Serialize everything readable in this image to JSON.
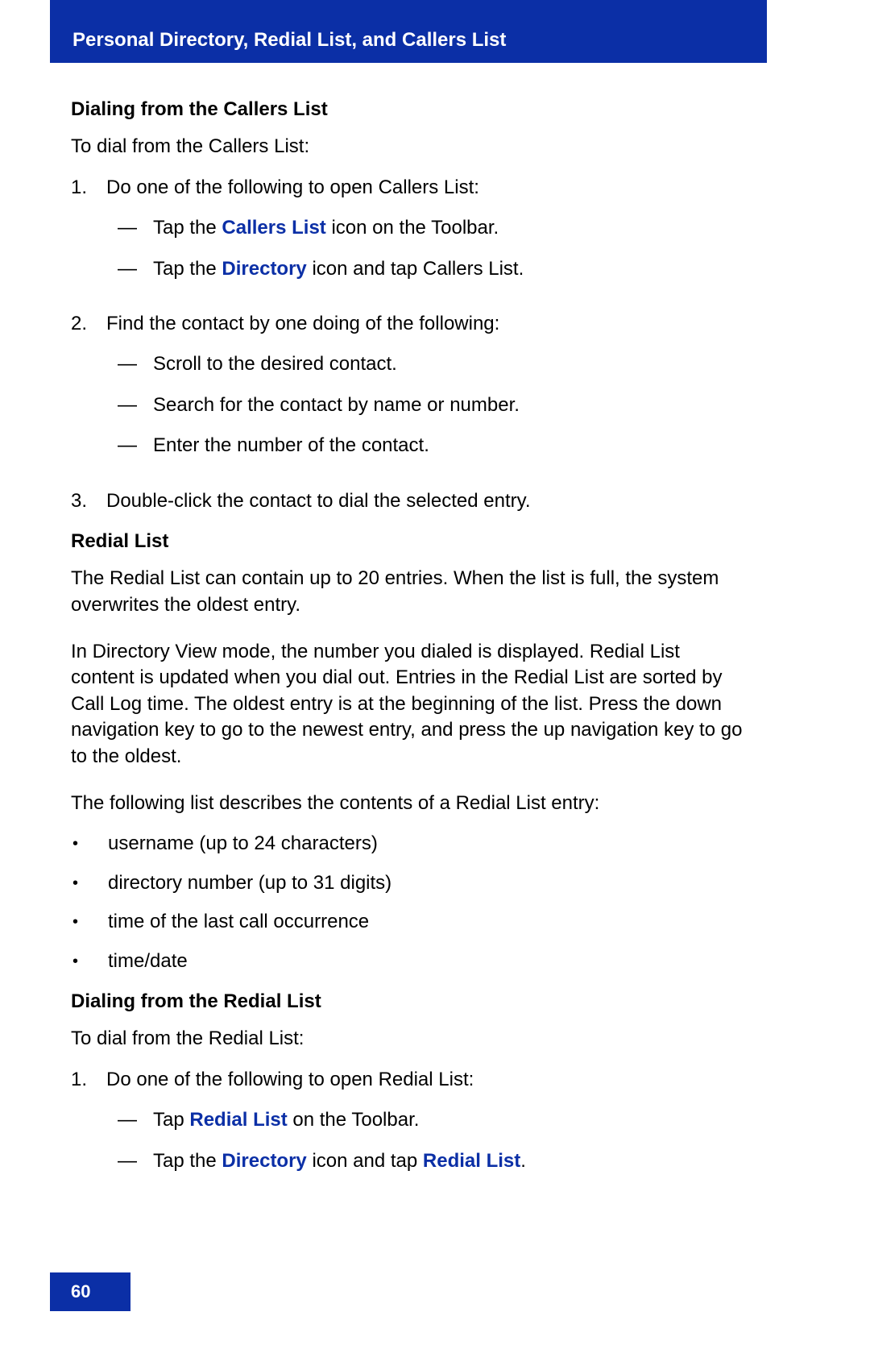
{
  "header": {
    "title": "Personal Directory, Redial List, and Callers List"
  },
  "footer": {
    "page_number": "60"
  },
  "section1": {
    "heading": "Dialing from the Callers List",
    "intro": "To dial from the Callers List:",
    "step1": {
      "num": "1.",
      "text": "Do one of the following to open Callers List:",
      "d1_pre": "Tap the ",
      "d1_link": "Callers List",
      "d1_post": " icon on the Toolbar.",
      "d2_pre": "Tap the ",
      "d2_link": "Directory",
      "d2_post": " icon and tap Callers List."
    },
    "step2": {
      "num": "2.",
      "text": "Find the contact by one doing of the following:",
      "d1": "Scroll to the desired contact.",
      "d2": "Search for the contact by name or number.",
      "d3": "Enter the number of the contact."
    },
    "step3": {
      "num": "3.",
      "text": "Double-click the contact to dial the selected entry."
    }
  },
  "section2": {
    "heading": "Redial List",
    "para1": "The Redial List can contain up to 20 entries. When the list is full, the system overwrites the oldest entry.",
    "para2": "In Directory View mode, the number you dialed is displayed. Redial List content is updated when you dial out. Entries in the Redial List are sorted by Call Log time. The oldest entry is at the beginning of the list. Press the down navigation key to go to the newest entry, and press the up navigation key to go to the oldest.",
    "para3": "The following list describes the contents of a Redial List entry:",
    "b1": "username (up to 24 characters)",
    "b2": "directory number (up to 31 digits)",
    "b3": "time of the last call occurrence",
    "b4": "time/date"
  },
  "section3": {
    "heading": "Dialing from the Redial List",
    "intro": "To dial from the Redial List:",
    "step1": {
      "num": "1.",
      "text": "Do one of the following to open Redial List:",
      "d1_pre": "Tap ",
      "d1_link": "Redial List",
      "d1_post": " on the Toolbar.",
      "d2_pre": "Tap the ",
      "d2_link1": "Directory",
      "d2_mid": " icon and tap ",
      "d2_link2": "Redial List",
      "d2_post": "."
    }
  },
  "dash": "—",
  "dot": "•"
}
